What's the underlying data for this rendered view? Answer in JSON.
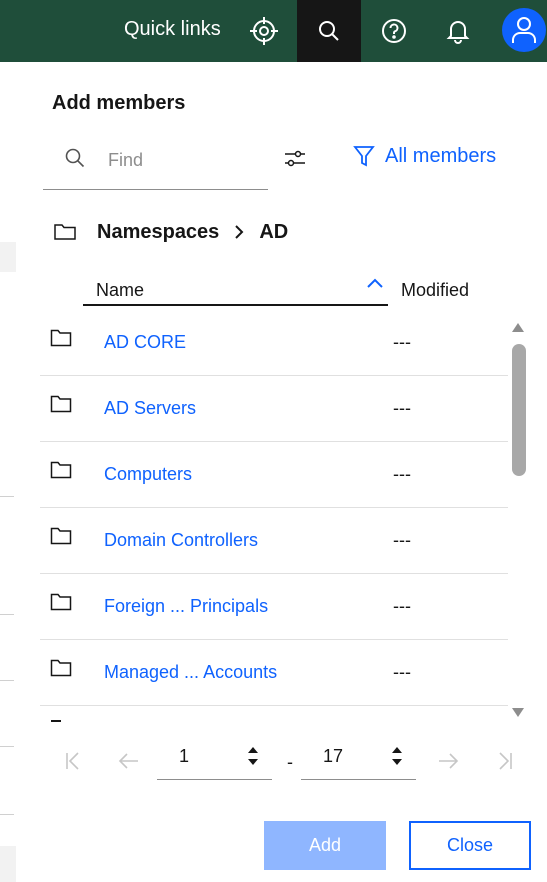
{
  "header": {
    "quick_links": "Quick links"
  },
  "panel": {
    "title": "Add members",
    "search_placeholder": "Find",
    "filter_label": "All members"
  },
  "breadcrumb": {
    "items": [
      "Namespaces",
      "AD"
    ]
  },
  "columns": {
    "name": "Name",
    "modified": "Modified"
  },
  "rows": [
    {
      "name": "AD CORE",
      "modified": "---"
    },
    {
      "name": "AD Servers",
      "modified": "---"
    },
    {
      "name": "Computers",
      "modified": "---"
    },
    {
      "name": "Domain Controllers",
      "modified": "---"
    },
    {
      "name": "Foreign ... Principals",
      "modified": "---"
    },
    {
      "name": "Managed ... Accounts",
      "modified": "---"
    }
  ],
  "pagination": {
    "start": "1",
    "separator": "-",
    "end": "17"
  },
  "buttons": {
    "add": "Add",
    "close": "Close"
  },
  "colors": {
    "header_bg": "#1f4e3a",
    "accent": "#0f62fe",
    "add_disabled": "#8fb6ff"
  }
}
